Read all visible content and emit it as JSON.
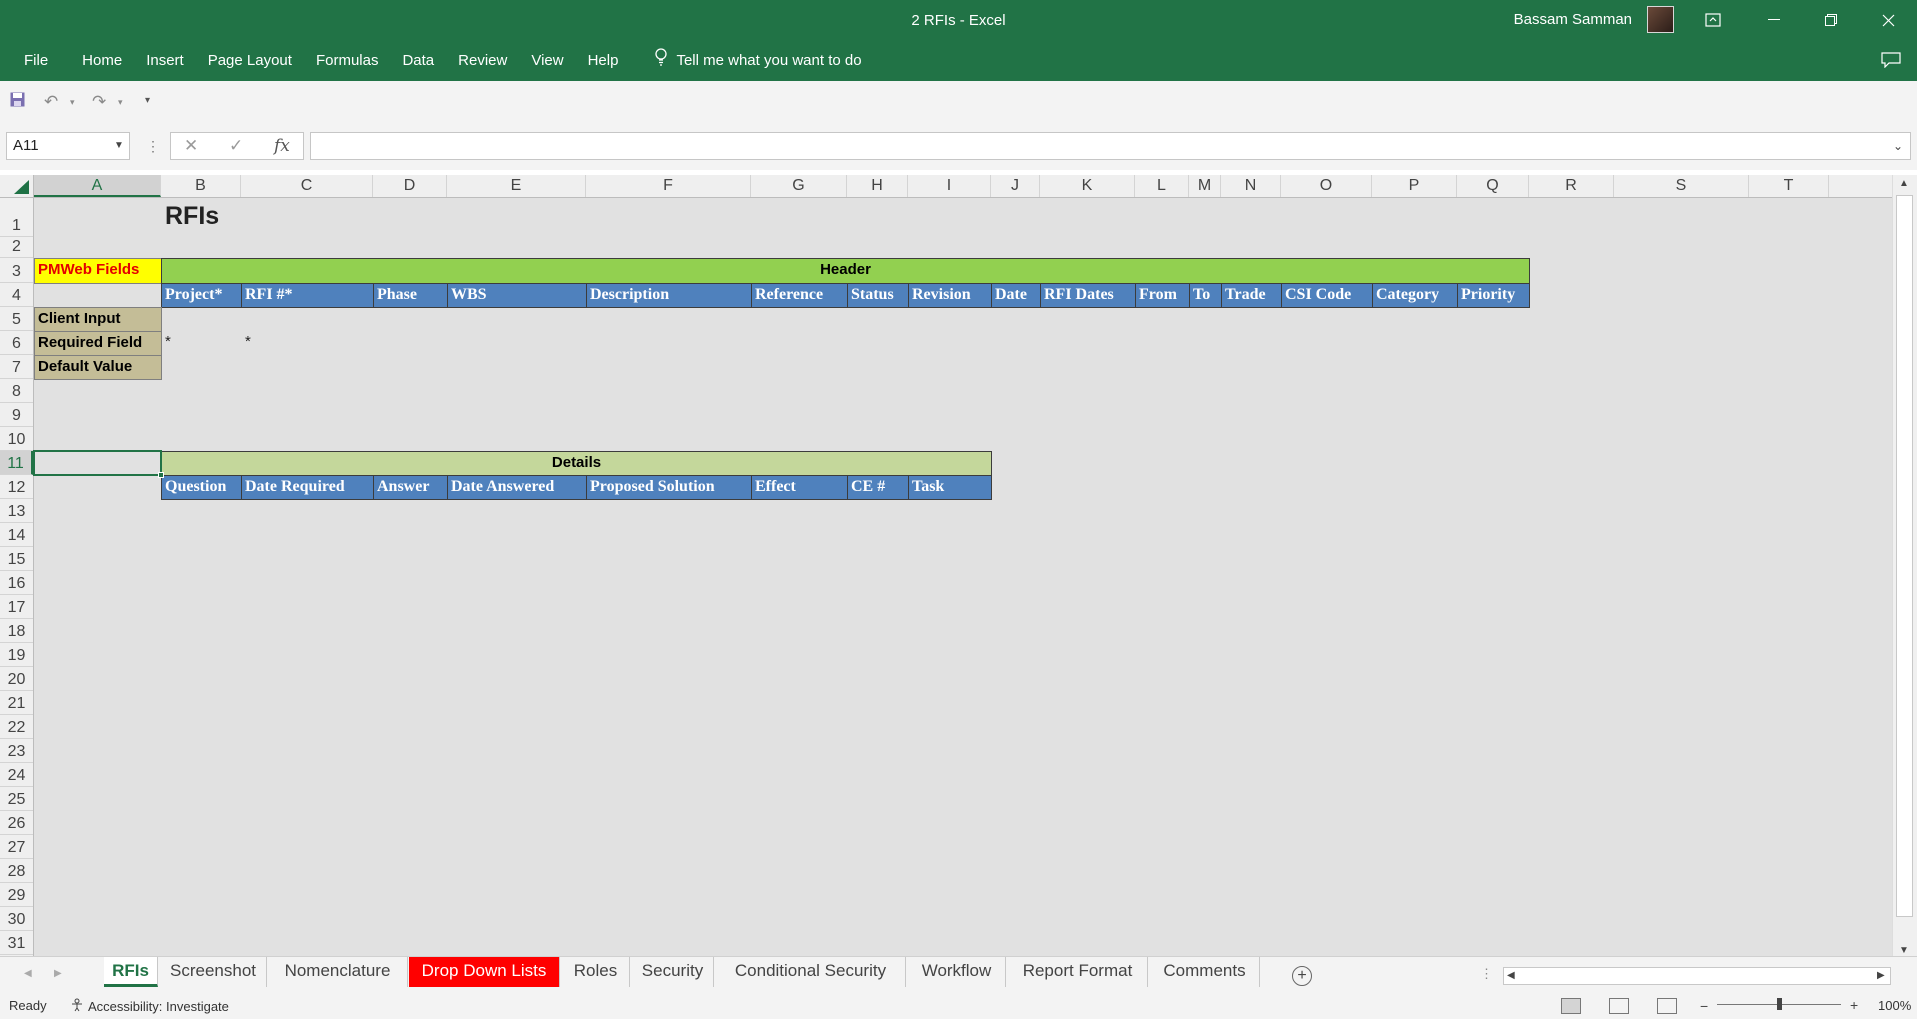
{
  "window": {
    "title": "2 RFIs  -  Excel",
    "user": "Bassam Samman"
  },
  "menu": {
    "file": "File",
    "items": [
      "Home",
      "Insert",
      "Page Layout",
      "Formulas",
      "Data",
      "Review",
      "View",
      "Help"
    ],
    "tell_me": "Tell me what you want to do"
  },
  "formula_bar": {
    "name_box": "A11",
    "fx": "fx",
    "formula": ""
  },
  "columns": [
    "A",
    "B",
    "C",
    "D",
    "E",
    "F",
    "G",
    "H",
    "I",
    "J",
    "K",
    "L",
    "M",
    "N",
    "O",
    "P",
    "Q",
    "R",
    "S",
    "T"
  ],
  "rows": [
    "1",
    "2",
    "3",
    "4",
    "5",
    "6",
    "7",
    "8",
    "9",
    "10",
    "11",
    "12",
    "13",
    "14",
    "15",
    "16",
    "17",
    "18",
    "19",
    "20",
    "21",
    "22",
    "23",
    "24",
    "25",
    "26",
    "27",
    "28",
    "29",
    "30",
    "31"
  ],
  "sheet": {
    "title": "RFIs",
    "pmweb_label": "PMWeb Fields",
    "header_band": "Header",
    "header_columns": [
      "Project*",
      "RFI #*",
      "Phase",
      "WBS",
      "Description",
      "Reference",
      "Status",
      "Revision",
      "Date",
      "RFI Dates",
      "From",
      "To",
      "Trade",
      "CSI Code",
      "Category",
      "Priority"
    ],
    "row_labels": [
      "Client Input",
      "Required Field",
      "Default Value"
    ],
    "required_marks": [
      "*",
      "*"
    ],
    "details_band": "Details",
    "details_columns": [
      "Question",
      "Date Required",
      "Answer",
      "Date Answered",
      "Proposed Solution",
      "Effect",
      "CE #",
      "Task"
    ]
  },
  "tabs": [
    "RFIs",
    "Screenshot",
    "Nomenclature",
    "Drop Down Lists",
    "Roles",
    "Security",
    "Conditional Security",
    "Workflow",
    "Report Format",
    "Comments"
  ],
  "status": {
    "ready": "Ready",
    "accessibility": "Accessibility: Investigate",
    "zoom": "100%"
  },
  "colors": {
    "excel_green": "#217346",
    "header_green": "#92d050",
    "details_green": "#c4d79b",
    "header_blue": "#4f81bd",
    "label_tan": "#c4bd97",
    "pmweb_yellow": "#ffff00",
    "dropdown_tab_red": "#ff0000"
  }
}
